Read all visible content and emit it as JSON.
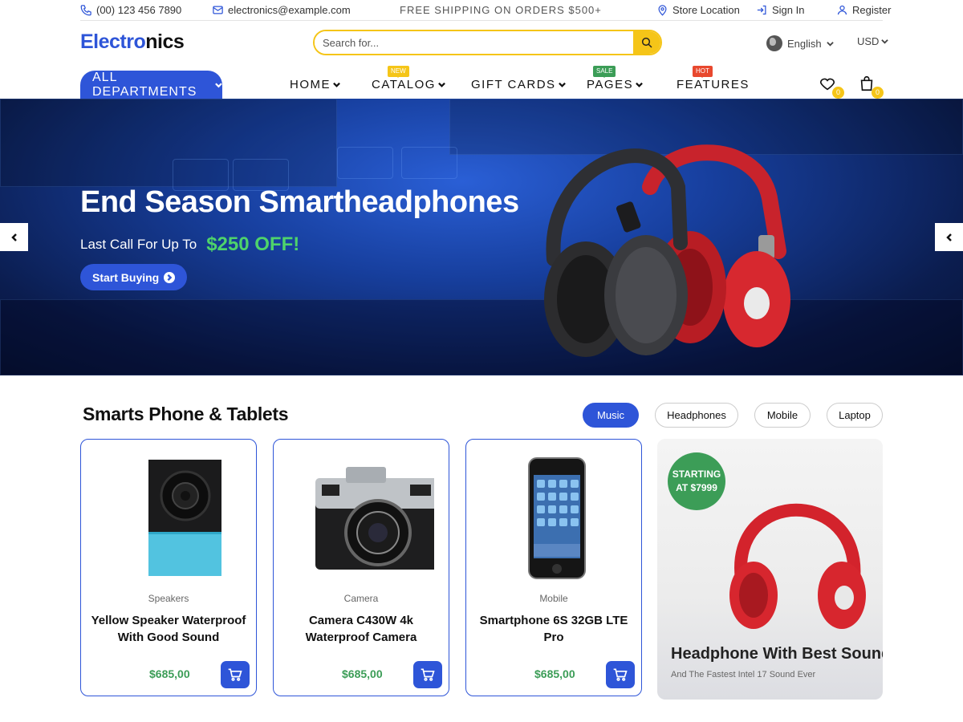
{
  "topbar": {
    "phone": "(00) 123 456 7890",
    "email": "electronics@example.com",
    "promo": "FREE SHIPPING ON ORDERS $500+",
    "store_location": "Store Location",
    "sign_in": "Sign In",
    "register": "Register"
  },
  "header": {
    "logo_part1": "Electro",
    "logo_part2": "nics",
    "search_placeholder": "Search for...",
    "language": "English",
    "currency": "USD",
    "wishlist_count": "0",
    "cart_count": "0"
  },
  "nav": {
    "departments": "ALL DEPARTMENTS",
    "items": [
      {
        "label": "HOME"
      },
      {
        "label": "CATALOG",
        "tag": "NEW"
      },
      {
        "label": "GIFT CARDS"
      },
      {
        "label": "PAGES",
        "tag": "SALE"
      },
      {
        "label": "FEATURES",
        "tag": "HOT"
      }
    ]
  },
  "hero": {
    "title": "End Season Smartheadphones",
    "subtitle": "Last Call For Up To",
    "discount": "$250 OFF!",
    "cta": "Start Buying"
  },
  "section": {
    "title": "Smarts Phone & Tablets",
    "filters": [
      "Music",
      "Headphones",
      "Mobile",
      "Laptop"
    ],
    "active_filter": "Music",
    "products": [
      {
        "category": "Speakers",
        "name": "Yellow Speaker Waterproof With Good Sound",
        "price": "$685,00"
      },
      {
        "category": "Camera",
        "name": "Camera C430W 4k Waterproof Camera",
        "price": "$685,00"
      },
      {
        "category": "Mobile",
        "name": "Smartphone 6S 32GB LTE Pro",
        "price": "$685,00"
      }
    ],
    "promo": {
      "badge_line1": "STARTING",
      "badge_line2": "AT $7999",
      "title": "Headphone With Best Sound",
      "subtitle": "And The Fastest Intel  17 Sound Ever"
    }
  },
  "colors": {
    "primary": "#2e55d8",
    "accent_yellow": "#f5c518",
    "green": "#3c9d57",
    "hot": "#e8482e"
  }
}
